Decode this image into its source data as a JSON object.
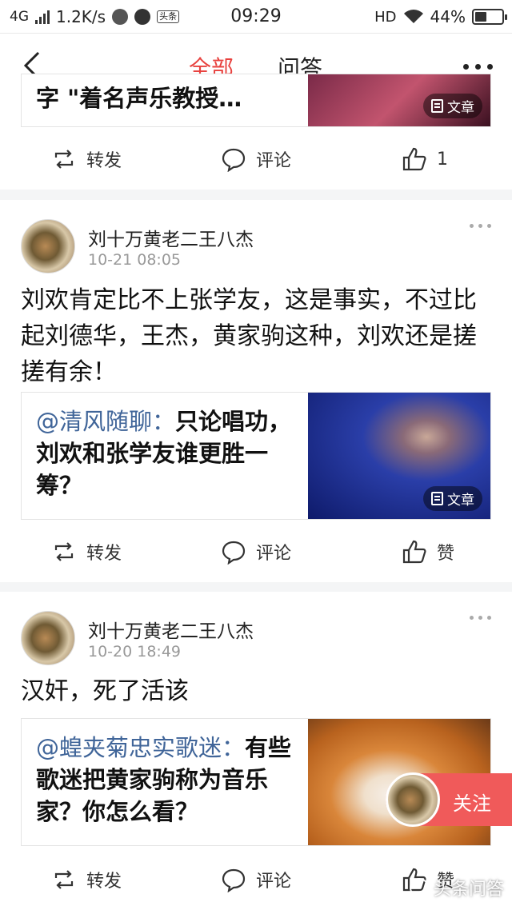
{
  "status_bar": {
    "network": "4G",
    "speed": "1.2K/s",
    "badge": "头条",
    "time": "09:29",
    "hd": "HD",
    "battery_pct": "44%",
    "battery_level": 0.44
  },
  "nav": {
    "tabs": [
      {
        "label": "全部",
        "active": true
      },
      {
        "label": "问答",
        "active": false
      }
    ]
  },
  "post0": {
    "ref_text_partial": "字 \"着名声乐教授…",
    "badge": "文章",
    "actions": {
      "repost": "转发",
      "comment": "评论",
      "like": "1"
    }
  },
  "post1": {
    "author": "刘十万黄老二王八杰",
    "time": "10-21 08:05",
    "text": "刘欢肯定比不上张学友，这是事实，不过比起刘德华，王杰，黄家驹这种，刘欢还是搓搓有余！",
    "ref_mention": "@清风随聊：",
    "ref_title": "只论唱功，刘欢和张学友谁更胜一筹？",
    "badge": "文章",
    "actions": {
      "repost": "转发",
      "comment": "评论",
      "like": "赞"
    }
  },
  "post2": {
    "author": "刘十万黄老二王八杰",
    "time": "10-20 18:49",
    "text": "汉奸，死了活该",
    "ref_mention": "@蝗夹菊忠实歌迷：",
    "ref_title": "有些歌迷把黄家驹称为音乐家？你怎么看？",
    "actions": {
      "repost": "转发",
      "comment": "评论",
      "like": "赞"
    }
  },
  "follow": {
    "label": "关注"
  },
  "watermark": "头条问答",
  "colors": {
    "accent": "#e8413e",
    "mention": "#406599",
    "follow": "#f05a5a"
  }
}
